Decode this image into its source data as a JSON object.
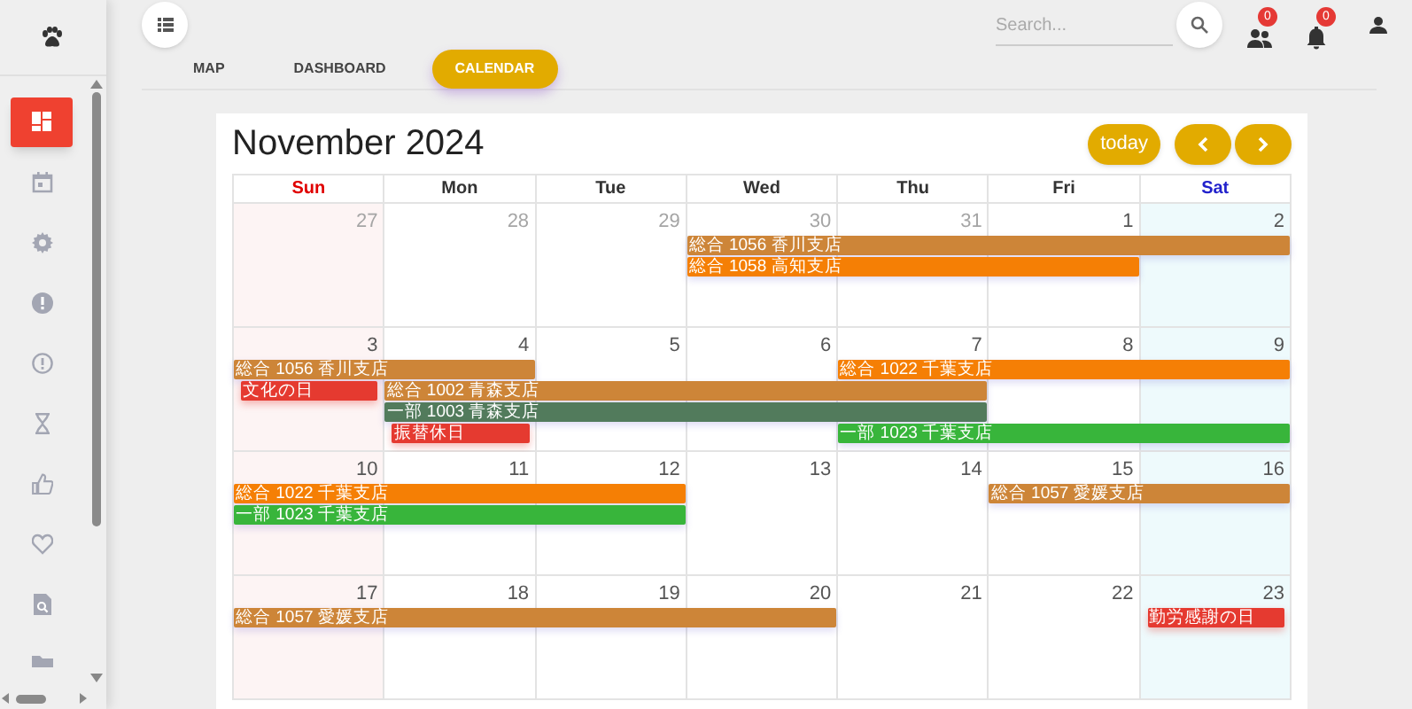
{
  "sidebar": {
    "items": [
      {
        "kind": "dashboard",
        "selected": true
      },
      {
        "kind": "calendar",
        "selected": false
      },
      {
        "kind": "gear",
        "selected": false
      },
      {
        "kind": "alert-filled",
        "selected": false
      },
      {
        "kind": "alert-outline",
        "selected": false
      },
      {
        "kind": "hourglass",
        "selected": false
      },
      {
        "kind": "thumbs-up",
        "selected": false
      },
      {
        "kind": "heart",
        "selected": false
      },
      {
        "kind": "file-search",
        "selected": false
      },
      {
        "kind": "folder",
        "selected": false
      }
    ]
  },
  "top_bar": {
    "search": {
      "placeholder": "Search..."
    },
    "badges": [
      {
        "kind": "group",
        "count": "0"
      },
      {
        "kind": "bell",
        "count": "0"
      }
    ]
  },
  "tabs": [
    {
      "label": "MAP",
      "selected": false
    },
    {
      "label": "DASHBOARD",
      "selected": false
    },
    {
      "label": "CALENDAR",
      "selected": true
    }
  ],
  "calendar": {
    "title": "November 2024",
    "today_button": "today",
    "weekdays": [
      {
        "label": "Sun",
        "kind": "sun"
      },
      {
        "label": "Mon",
        "kind": "weekday"
      },
      {
        "label": "Tue",
        "kind": "weekday"
      },
      {
        "label": "Wed",
        "kind": "weekday"
      },
      {
        "label": "Thu",
        "kind": "weekday"
      },
      {
        "label": "Fri",
        "kind": "weekday"
      },
      {
        "label": "Sat",
        "kind": "sat"
      }
    ],
    "weeks": [
      {
        "days": [
          {
            "label": "27",
            "other_month": true
          },
          {
            "label": "28",
            "other_month": true
          },
          {
            "label": "29",
            "other_month": true
          },
          {
            "label": "30",
            "other_month": true
          },
          {
            "label": "31",
            "other_month": true
          },
          {
            "label": "1",
            "other_month": false
          },
          {
            "label": "2",
            "other_month": false
          }
        ],
        "lanes": [
          [
            {
              "kind": "empty"
            },
            {
              "kind": "empty"
            },
            {
              "kind": "empty"
            },
            {
              "kind": "event",
              "title": "総合 1056 香川支店",
              "color": "#cd8538"
            },
            {
              "kind": "continued"
            },
            {
              "kind": "continued"
            },
            {
              "kind": "continued"
            }
          ],
          [
            {
              "kind": "empty"
            },
            {
              "kind": "empty"
            },
            {
              "kind": "empty"
            },
            {
              "kind": "event",
              "title": "総合 1058 高知支店",
              "color": "#f57f05"
            },
            {
              "kind": "continued"
            },
            {
              "kind": "continued"
            },
            {
              "kind": "empty"
            }
          ]
        ]
      },
      {
        "days": [
          {
            "label": "3",
            "other_month": false
          },
          {
            "label": "4",
            "other_month": false
          },
          {
            "label": "5",
            "other_month": false
          },
          {
            "label": "6",
            "other_month": false
          },
          {
            "label": "7",
            "other_month": false
          },
          {
            "label": "8",
            "other_month": false
          },
          {
            "label": "9",
            "other_month": false
          }
        ],
        "lanes": [
          [
            {
              "kind": "event",
              "title": "総合 1056 香川支店",
              "color": "#cd8538"
            },
            {
              "kind": "continued"
            },
            {
              "kind": "empty"
            },
            {
              "kind": "empty"
            },
            {
              "kind": "event",
              "title": "総合 1022 千葉支店",
              "color": "#f57f05"
            },
            {
              "kind": "continued"
            },
            {
              "kind": "continued"
            }
          ],
          [
            {
              "kind": "holiday",
              "title": "文化の日",
              "color": "#e53a30"
            },
            {
              "kind": "event",
              "title": "総合 1002 青森支店",
              "color": "#cd8538"
            },
            {
              "kind": "continued"
            },
            {
              "kind": "continued"
            },
            {
              "kind": "continued"
            },
            {
              "kind": "empty"
            },
            {
              "kind": "empty"
            }
          ],
          [
            {
              "kind": "empty"
            },
            {
              "kind": "event",
              "title": "一部 1003 青森支店",
              "color": "#527b5c"
            },
            {
              "kind": "continued"
            },
            {
              "kind": "continued"
            },
            {
              "kind": "continued"
            },
            {
              "kind": "empty"
            },
            {
              "kind": "empty"
            }
          ],
          [
            {
              "kind": "empty"
            },
            {
              "kind": "holiday",
              "title": "振替休日",
              "color": "#e53a30"
            },
            {
              "kind": "empty"
            },
            {
              "kind": "empty"
            },
            {
              "kind": "event",
              "title": "一部 1023 千葉支店",
              "color": "#38b53b"
            },
            {
              "kind": "continued"
            },
            {
              "kind": "continued"
            }
          ]
        ]
      },
      {
        "days": [
          {
            "label": "10",
            "other_month": false
          },
          {
            "label": "11",
            "other_month": false
          },
          {
            "label": "12",
            "other_month": false
          },
          {
            "label": "13",
            "other_month": false
          },
          {
            "label": "14",
            "other_month": false
          },
          {
            "label": "15",
            "other_month": false
          },
          {
            "label": "16",
            "other_month": false
          }
        ],
        "lanes": [
          [
            {
              "kind": "event",
              "title": "総合 1022 千葉支店",
              "color": "#f57f05"
            },
            {
              "kind": "continued"
            },
            {
              "kind": "continued"
            },
            {
              "kind": "empty"
            },
            {
              "kind": "empty"
            },
            {
              "kind": "event",
              "title": "総合 1057 愛媛支店",
              "color": "#cd8538"
            },
            {
              "kind": "continued"
            }
          ],
          [
            {
              "kind": "event",
              "title": "一部 1023 千葉支店",
              "color": "#38b53b"
            },
            {
              "kind": "continued"
            },
            {
              "kind": "continued"
            },
            {
              "kind": "empty"
            },
            {
              "kind": "empty"
            },
            {
              "kind": "empty"
            },
            {
              "kind": "empty"
            }
          ]
        ]
      },
      {
        "days": [
          {
            "label": "17",
            "other_month": false
          },
          {
            "label": "18",
            "other_month": false
          },
          {
            "label": "19",
            "other_month": false
          },
          {
            "label": "20",
            "other_month": false
          },
          {
            "label": "21",
            "other_month": false
          },
          {
            "label": "22",
            "other_month": false
          },
          {
            "label": "23",
            "other_month": false
          }
        ],
        "lanes": [
          [
            {
              "kind": "event",
              "title": "総合 1057 愛媛支店",
              "color": "#cd8538"
            },
            {
              "kind": "continued"
            },
            {
              "kind": "continued"
            },
            {
              "kind": "continued"
            },
            {
              "kind": "empty"
            },
            {
              "kind": "empty"
            },
            {
              "kind": "holiday",
              "title": "勤労感謝の日",
              "color": "#e53a30"
            }
          ]
        ]
      }
    ]
  }
}
